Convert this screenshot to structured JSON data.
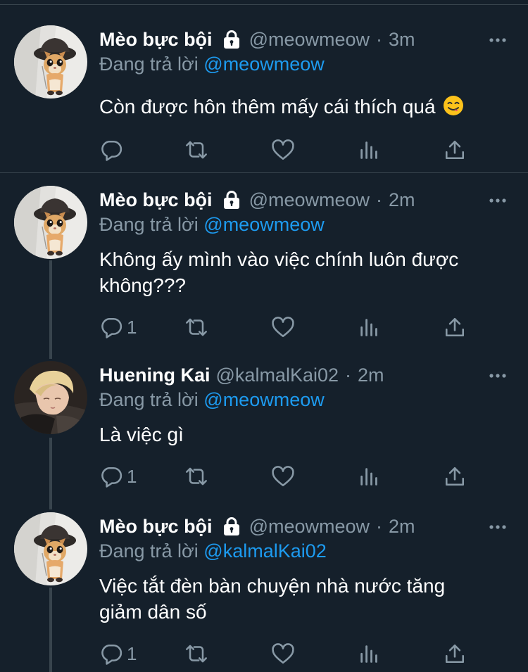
{
  "colors": {
    "background": "#15202b",
    "secondary_text": "#8899a6",
    "link": "#1d9bf0",
    "divider": "#38444d"
  },
  "tweets": [
    {
      "name": "Mèo bực bội",
      "protected": true,
      "handle": "@meowmeow",
      "separator": "·",
      "time": "3m",
      "reply_prefix": "Đang trả lời",
      "reply_to": "@meowmeow",
      "text": "Còn được hôn thêm mấy cái thích quá",
      "emoji": "yum-face",
      "reply_count": ""
    },
    {
      "name": "Mèo bực bội",
      "protected": true,
      "handle": "@meowmeow",
      "separator": "·",
      "time": "2m",
      "reply_prefix": "Đang trả lời",
      "reply_to": "@meowmeow",
      "text_line1": "Không ấy mình vào việc chính luôn được",
      "text_line2": "không???",
      "reply_count": "1"
    },
    {
      "name": "Huening Kai",
      "protected": false,
      "handle": "@kalmalKai02",
      "separator": "·",
      "time": "2m",
      "reply_prefix": "Đang trả lời",
      "reply_to": "@meowmeow",
      "text": "Là việc gì",
      "reply_count": "1"
    },
    {
      "name": "Mèo bực bội",
      "protected": true,
      "handle": "@meowmeow",
      "separator": "·",
      "time": "2m",
      "reply_prefix": "Đang trả lời",
      "reply_to": "@kalmalKai02",
      "text_line1": "Việc tắt đèn bàn chuyện nhà nước tăng",
      "text_line2": "giảm dân số",
      "reply_count": "1"
    }
  ],
  "icons": {
    "protected": "lock-icon",
    "more": "more-icon",
    "reply": "reply-icon",
    "retweet": "retweet-icon",
    "like": "heart-icon",
    "analytics": "analytics-icon",
    "share": "share-icon"
  }
}
